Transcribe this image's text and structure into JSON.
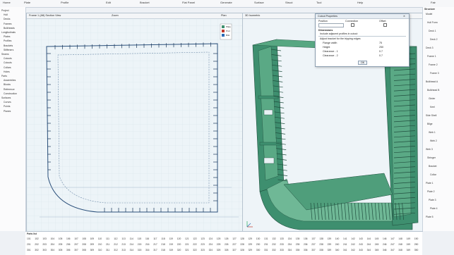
{
  "ribbon": {
    "tabs": [
      "Home",
      "Plate",
      "Profile",
      "Edit",
      "Bracket",
      "Flat Panel",
      "Generate",
      "Surface",
      "Struct",
      "Tool",
      "Help"
    ],
    "right_label": "Fair"
  },
  "left_panel": {
    "items": [
      "Project",
      "Hull",
      "Decks",
      "Frames",
      "Bulkheads",
      "Longitudinals",
      "Plates",
      "Profiles",
      "Brackets",
      "Stiffeners",
      "Seams",
      "Cutouts",
      "Cutouts",
      "Collars",
      "Holes",
      "Parts",
      "Assemblies",
      "Blocks",
      "Reference",
      "Construction",
      "Surfaces",
      "Curves",
      "Points",
      "Planes"
    ]
  },
  "viewport_left": {
    "header_left": "Frame 1 (Aft)  Section View",
    "header_mid": "Zoom",
    "header_right": "Plan",
    "legend": [
      "Plate",
      "Prof.",
      "Brkt"
    ]
  },
  "viewport_right": {
    "header_left": "3D  Isometric",
    "header_right": "Shaded"
  },
  "dialog": {
    "title": "Cutout Properties",
    "col_headers": [
      "Position",
      "Connection",
      "Offset"
    ],
    "section1": "Dimensions",
    "option_label": "Include adjacent profiles in cutout",
    "sub_option": "Adjust bracket for the tripping edges",
    "rows": [
      {
        "label": "Flange width",
        "value": "75"
      },
      {
        "label": "Height",
        "value": "250"
      },
      {
        "label": "Clearance - 1",
        "value": "0.7"
      },
      {
        "label": "Clearance - 2",
        "value": "0.7"
      }
    ],
    "footer": "OK"
  },
  "right_panel": {
    "header": "Structure",
    "items": [
      "Model",
      "Hull Form",
      "Deck 1",
      "Deck 2",
      "Deck 3",
      "Frame 1",
      "Frame 2",
      "Frame 3",
      "Bulkhead A",
      "Bulkhead B",
      "Girder",
      "Keel",
      "Side Shell",
      "Bilge",
      "Web 1",
      "Web 2",
      "Web 3",
      "Stringer",
      "Bracket",
      "Collar",
      "Plate 1",
      "Plate 2",
      "Plate 3",
      "Plate 4",
      "Plate 5"
    ]
  },
  "bottom_panel": {
    "header": "Parts list",
    "row1": [
      "101",
      "102",
      "103",
      "104",
      "105",
      "106",
      "107",
      "108",
      "109",
      "110",
      "111",
      "112",
      "113",
      "114",
      "115",
      "116",
      "117",
      "118",
      "119",
      "120",
      "121",
      "122",
      "123",
      "124",
      "125",
      "126",
      "127",
      "128",
      "129",
      "130",
      "131",
      "132",
      "133",
      "134",
      "135",
      "136",
      "137",
      "138",
      "139",
      "140",
      "141",
      "142",
      "143",
      "144",
      "145",
      "146",
      "147",
      "148",
      "149",
      "150"
    ],
    "row2": [
      "201",
      "202",
      "203",
      "204",
      "205",
      "206",
      "207",
      "208",
      "209",
      "210",
      "211",
      "212",
      "213",
      "214",
      "215",
      "216",
      "217",
      "218",
      "219",
      "220",
      "221",
      "222",
      "223",
      "224",
      "225",
      "226",
      "227",
      "228",
      "229",
      "230",
      "231",
      "232",
      "233",
      "234",
      "235",
      "236",
      "237",
      "238",
      "239",
      "240",
      "241",
      "242",
      "243",
      "244",
      "245",
      "246",
      "247",
      "248",
      "249",
      "250"
    ],
    "row3": [
      "301",
      "302",
      "303",
      "304",
      "305",
      "306",
      "307",
      "308",
      "309",
      "310",
      "311",
      "312",
      "313",
      "314",
      "315",
      "316",
      "317",
      "318",
      "319",
      "320",
      "321",
      "322",
      "323",
      "324",
      "325",
      "326",
      "327",
      "328",
      "329",
      "330",
      "331",
      "332",
      "333",
      "334",
      "335",
      "336",
      "337",
      "338",
      "339",
      "340",
      "341",
      "342",
      "343",
      "344",
      "345",
      "346",
      "347",
      "348",
      "349",
      "350"
    ]
  },
  "colors": {
    "hull": "#3e8f6f",
    "hull_dark": "#2b6c53",
    "hull_light": "#6fb896",
    "accent": "#2a6bb5"
  }
}
